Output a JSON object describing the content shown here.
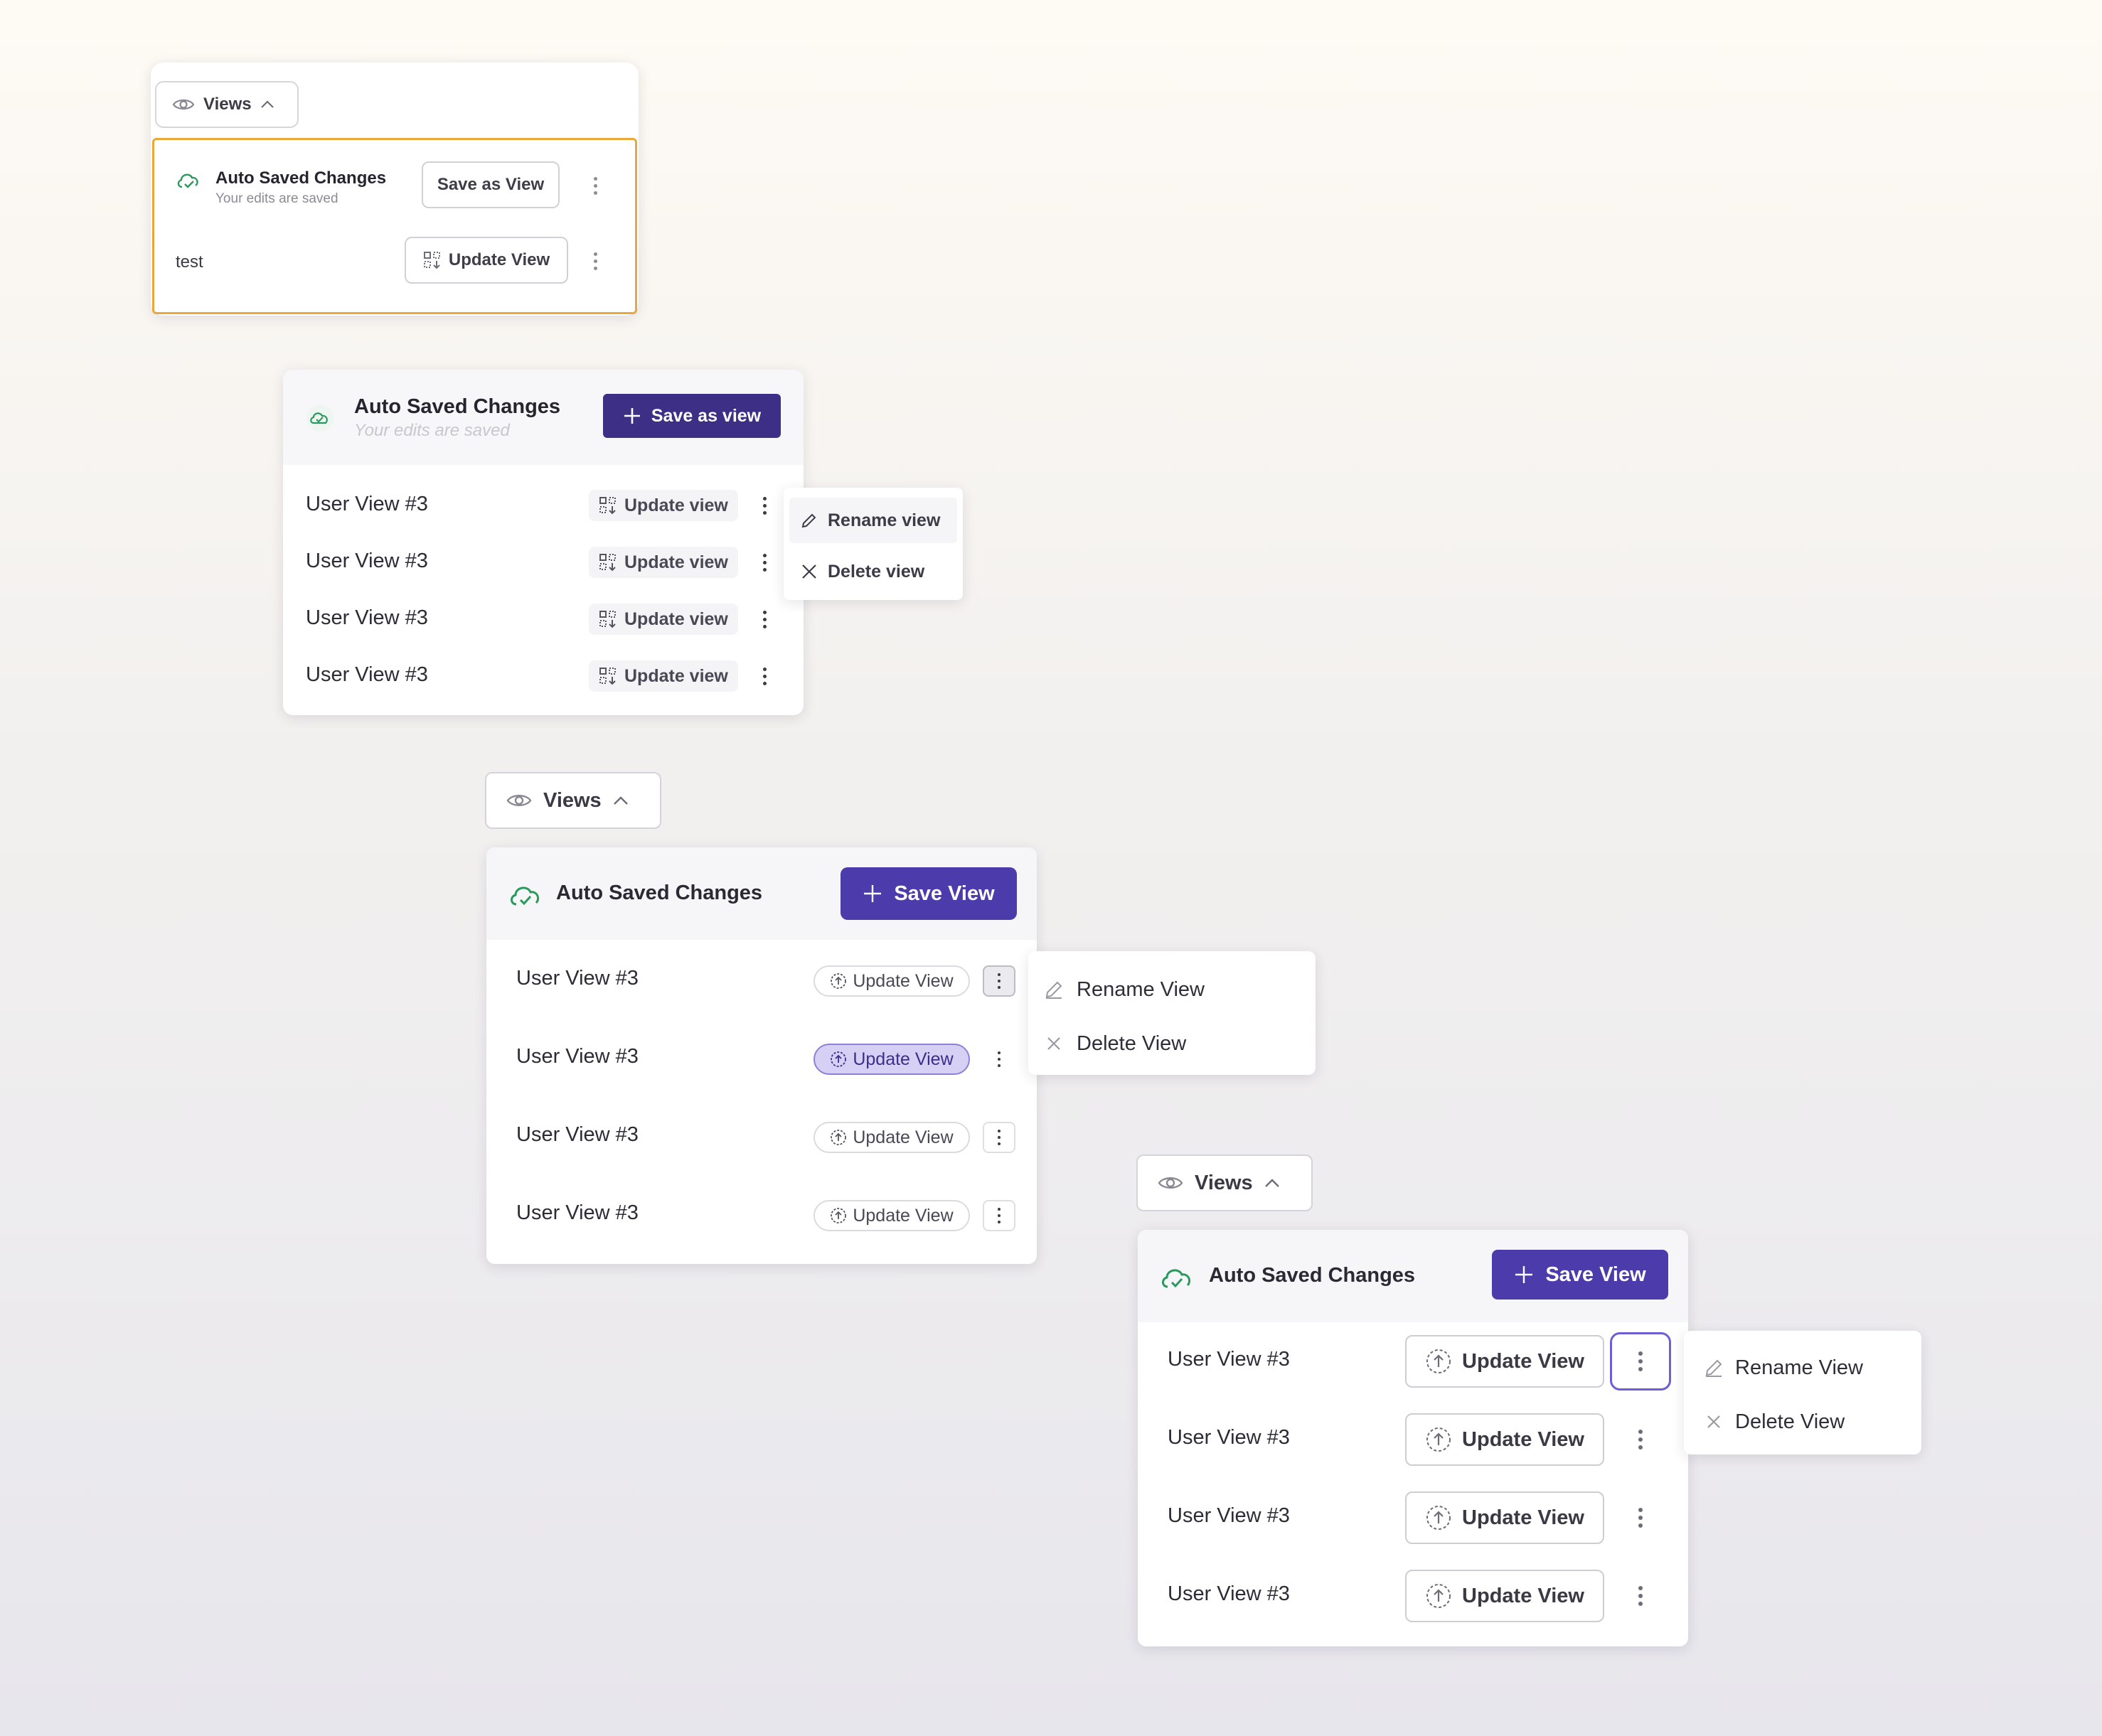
{
  "colors": {
    "accent_dark": "#3d2e86",
    "accent": "#4b3bab",
    "focus_ring": "#6c5ed6",
    "active_chip": "#d6d0f5",
    "success_green": "#2a9a5c",
    "highlight_border": "#e9a83a"
  },
  "panel_a": {
    "views_label": "Views",
    "title": "Auto Saved Changes",
    "subtitle": "Your edits are saved",
    "save_label": "Save as View",
    "row_name": "test",
    "update_label": "Update View"
  },
  "panel_b": {
    "title": "Auto Saved Changes",
    "subtitle": "Your edits are saved",
    "save_label": "Save as view",
    "rows": [
      {
        "name": "User View #3",
        "update": "Update view"
      },
      {
        "name": "User View #3",
        "update": "Update view"
      },
      {
        "name": "User View #3",
        "update": "Update view"
      },
      {
        "name": "User View #3",
        "update": "Update view"
      }
    ],
    "menu": {
      "rename": "Rename view",
      "delete": "Delete view"
    }
  },
  "panel_c": {
    "views_label": "Views",
    "title": "Auto Saved Changes",
    "save_label": "Save View",
    "rows": [
      {
        "name": "User View #3",
        "update": "Update View"
      },
      {
        "name": "User View #3",
        "update": "Update View"
      },
      {
        "name": "User View #3",
        "update": "Update View"
      },
      {
        "name": "User View #3",
        "update": "Update View"
      }
    ],
    "menu": {
      "rename": "Rename View",
      "delete": "Delete View"
    }
  },
  "panel_d": {
    "views_label": "Views",
    "title": "Auto Saved Changes",
    "save_label": "Save View",
    "rows": [
      {
        "name": "User View #3",
        "update": "Update View"
      },
      {
        "name": "User View #3",
        "update": "Update View"
      },
      {
        "name": "User View #3",
        "update": "Update View"
      },
      {
        "name": "User View #3",
        "update": "Update View"
      }
    ],
    "menu": {
      "rename": "Rename View",
      "delete": "Delete View"
    }
  }
}
